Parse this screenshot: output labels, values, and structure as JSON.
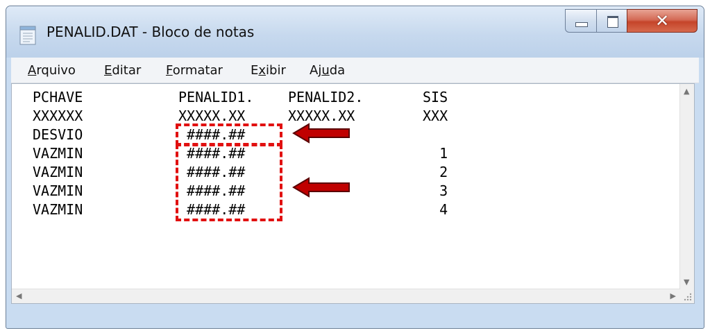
{
  "window": {
    "title": "PENALID.DAT - Bloco de notas"
  },
  "menu": [
    {
      "label": "Arquivo",
      "underline_index": 0
    },
    {
      "label": "Editar",
      "underline_index": 0
    },
    {
      "label": "Formatar",
      "underline_index": 0
    },
    {
      "label": "Exibir",
      "underline_index": 1
    },
    {
      "label": "Ajuda",
      "underline_index": 2
    }
  ],
  "document": {
    "rows": [
      {
        "c1": "PCHAVE",
        "c2": "PENALID1.",
        "c3": "PENALID2.",
        "c4": "SIS"
      },
      {
        "c1": "XXXXXX",
        "c2": "XXXXX.XX",
        "c3": "XXXXX.XX",
        "c4": "XXX"
      },
      {
        "c1": "DESVIO",
        "c2": " ####.##",
        "c3": "",
        "c4": ""
      },
      {
        "c1": "VAZMIN",
        "c2": " ####.##",
        "c3": "",
        "c4": "  1"
      },
      {
        "c1": "VAZMIN",
        "c2": " ####.##",
        "c3": "",
        "c4": "  2"
      },
      {
        "c1": "VAZMIN",
        "c2": " ####.##",
        "c3": "",
        "c4": "  3"
      },
      {
        "c1": "VAZMIN",
        "c2": " ####.##",
        "c3": "",
        "c4": "  4"
      }
    ]
  },
  "annotations": {
    "highlight_color": "#e11010",
    "arrow_color": "#c00000"
  }
}
